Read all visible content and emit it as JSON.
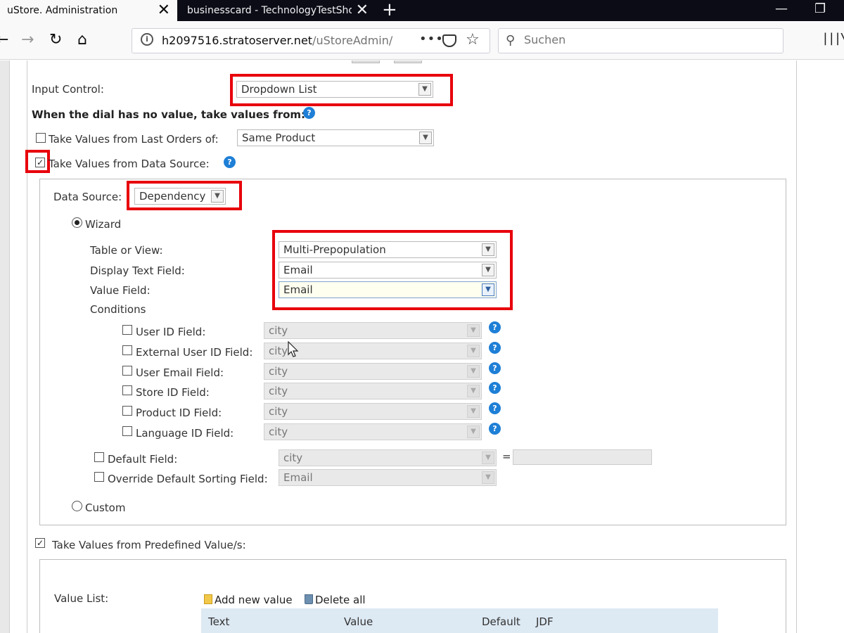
{
  "browser": {
    "tabs": [
      {
        "title": "uStore. Administration",
        "active": true
      },
      {
        "title": "businesscard - TechnologyTestShop",
        "active": false
      }
    ],
    "new_tab_symbol": "+",
    "url_host": "h2097516.stratoserver.net",
    "url_path": "/uStoreAdmin/",
    "search_placeholder": "Suchen",
    "icons": [
      "back-icon",
      "forward-icon",
      "reload-icon",
      "home-icon",
      "page-info-icon",
      "page-actions-icon",
      "pocket-icon",
      "bookmark-star-icon",
      "search-icon",
      "library-icon"
    ]
  },
  "form": {
    "input_control_label": "Input Control:",
    "input_control_value": "Dropdown List",
    "no_value_heading": "When the dial has no value, take values from:",
    "last_orders_label": "Take Values from Last Orders of:",
    "last_orders_value": "Same Product",
    "last_orders_checked": false,
    "data_source_cb_label": "Take Values from Data Source:",
    "data_source_checked": true,
    "data_source": {
      "label": "Data Source:",
      "value": "Dependency",
      "wizard_label": "Wizard",
      "wizard_selected": true,
      "table_label": "Table or View:",
      "table_value": "Multi-Prepopulation",
      "display_label": "Display Text Field:",
      "display_value": "Email",
      "value_field_label": "Value Field:",
      "value_field_value": "Email",
      "conditions_label": "Conditions",
      "conditions": [
        {
          "label": "User ID Field:",
          "value": "city"
        },
        {
          "label": "External User ID Field:",
          "value": "city"
        },
        {
          "label": "User Email Field:",
          "value": "city"
        },
        {
          "label": "Store ID Field:",
          "value": "city"
        },
        {
          "label": "Product ID Field:",
          "value": "city"
        },
        {
          "label": "Language ID Field:",
          "value": "city"
        }
      ],
      "default_field_label": "Default Field:",
      "default_field_value": "city",
      "equals": "=",
      "override_label": "Override Default Sorting Field:",
      "override_value": "Email",
      "custom_label": "Custom"
    },
    "predefined_label": "Take Values from Predefined Value/s:",
    "predefined_checked": true,
    "value_list_label": "Value List:",
    "add_new_value": "Add new value",
    "delete_all": "Delete all",
    "table_headers": [
      "Text",
      "Value",
      "Default",
      "JDF"
    ]
  },
  "colors": {
    "highlight_red": "#e8000b",
    "help_blue": "#1e7fd6",
    "table_header_bg": "#dde9f3"
  }
}
